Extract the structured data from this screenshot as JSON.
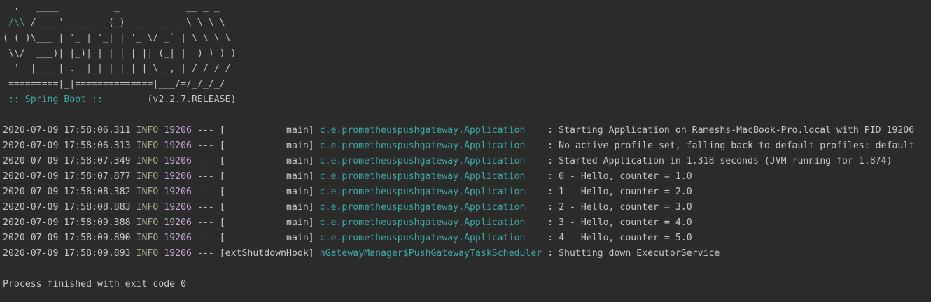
{
  "banner": {
    "lines": [
      "  .   ____          _            __ _ _",
      " /\\\\ / ___'_ __ _ _(_)_ __  __ _ \\ \\ \\ \\",
      "( ( )\\___ | '_ | '_| | '_ \\/ _` | \\ \\ \\ \\",
      " \\\\/  ___)| |_)| | | | | || (_| |  ) ) ) )",
      "  '  |____| .__|_| |_|_| |_\\__, | / / / /",
      " =========|_|==============|___/=/_/_/_/"
    ],
    "accent": "/\\\\",
    "spring_label": " :: Spring Boot :: ",
    "spring_version": "       (v2.2.7.RELEASE)"
  },
  "colors": {
    "background": "#2b2b2b",
    "text": "#c8c8c8",
    "logger": "#3fa9a2",
    "level": "#a9a98c"
  },
  "logs": [
    {
      "timestamp": "2020-07-09 17:58:06.311",
      "level": "INFO",
      "pid": "19206",
      "separator": "---",
      "thread": "           main",
      "logger": "c.e.prometheuspushgateway.Application   ",
      "message": ": Starting Application on Rameshs-MacBook-Pro.local with PID 19206"
    },
    {
      "timestamp": "2020-07-09 17:58:06.313",
      "level": "INFO",
      "pid": "19206",
      "separator": "---",
      "thread": "           main",
      "logger": "c.e.prometheuspushgateway.Application   ",
      "message": ": No active profile set, falling back to default profiles: default"
    },
    {
      "timestamp": "2020-07-09 17:58:07.349",
      "level": "INFO",
      "pid": "19206",
      "separator": "---",
      "thread": "           main",
      "logger": "c.e.prometheuspushgateway.Application   ",
      "message": ": Started Application in 1.318 seconds (JVM running for 1.874)"
    },
    {
      "timestamp": "2020-07-09 17:58:07.877",
      "level": "INFO",
      "pid": "19206",
      "separator": "---",
      "thread": "           main",
      "logger": "c.e.prometheuspushgateway.Application   ",
      "message": ": 0 - Hello, counter = 1.0"
    },
    {
      "timestamp": "2020-07-09 17:58:08.382",
      "level": "INFO",
      "pid": "19206",
      "separator": "---",
      "thread": "           main",
      "logger": "c.e.prometheuspushgateway.Application   ",
      "message": ": 1 - Hello, counter = 2.0"
    },
    {
      "timestamp": "2020-07-09 17:58:08.883",
      "level": "INFO",
      "pid": "19206",
      "separator": "---",
      "thread": "           main",
      "logger": "c.e.prometheuspushgateway.Application   ",
      "message": ": 2 - Hello, counter = 3.0"
    },
    {
      "timestamp": "2020-07-09 17:58:09.388",
      "level": "INFO",
      "pid": "19206",
      "separator": "---",
      "thread": "           main",
      "logger": "c.e.prometheuspushgateway.Application   ",
      "message": ": 3 - Hello, counter = 4.0"
    },
    {
      "timestamp": "2020-07-09 17:58:09.890",
      "level": "INFO",
      "pid": "19206",
      "separator": "---",
      "thread": "           main",
      "logger": "c.e.prometheuspushgateway.Application   ",
      "message": ": 4 - Hello, counter = 5.0"
    },
    {
      "timestamp": "2020-07-09 17:58:09.893",
      "level": "INFO",
      "pid": "19206",
      "separator": "---",
      "thread": "extShutdownHook",
      "logger": "hGatewayManager$PushGatewayTaskScheduler",
      "message": ": Shutting down ExecutorService"
    }
  ],
  "exit_message": "Process finished with exit code 0"
}
